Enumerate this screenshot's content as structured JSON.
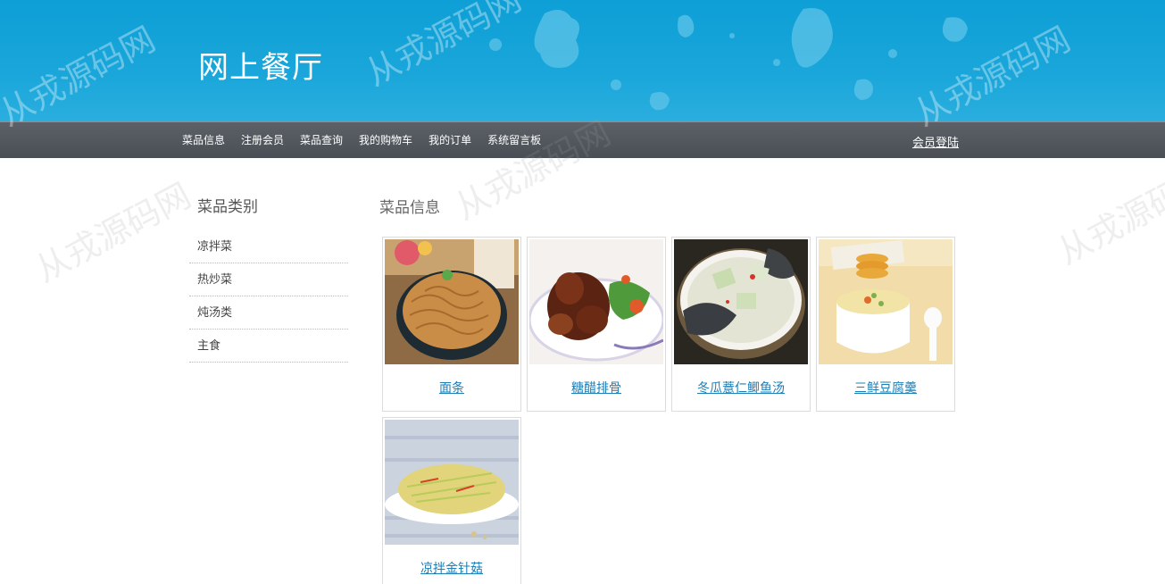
{
  "header": {
    "site_title": "网上餐厅"
  },
  "nav": {
    "links": [
      "菜品信息",
      "注册会员",
      "菜品查询",
      "我的购物车",
      "我的订单",
      "系统留言板"
    ],
    "login": "会员登陆"
  },
  "sidebar": {
    "title": "菜品类别",
    "categories": [
      "凉拌菜",
      "热炒菜",
      "炖汤类",
      "主食"
    ]
  },
  "main": {
    "title": "菜品信息",
    "dishes": [
      {
        "name": "面条",
        "icon": "noodles-image"
      },
      {
        "name": "糖醋排骨",
        "icon": "sweet-sour-ribs-image"
      },
      {
        "name": "冬瓜薏仁鲫鱼汤",
        "icon": "fish-soup-image"
      },
      {
        "name": "三鲜豆腐羹",
        "icon": "tofu-soup-image"
      },
      {
        "name": "凉拌金针菇",
        "icon": "enoki-salad-image"
      }
    ]
  },
  "watermark": "从戎源码网",
  "colors": {
    "banner": "#0d9fd6",
    "navbar": "#4d5258",
    "link": "#1d7fb6"
  }
}
